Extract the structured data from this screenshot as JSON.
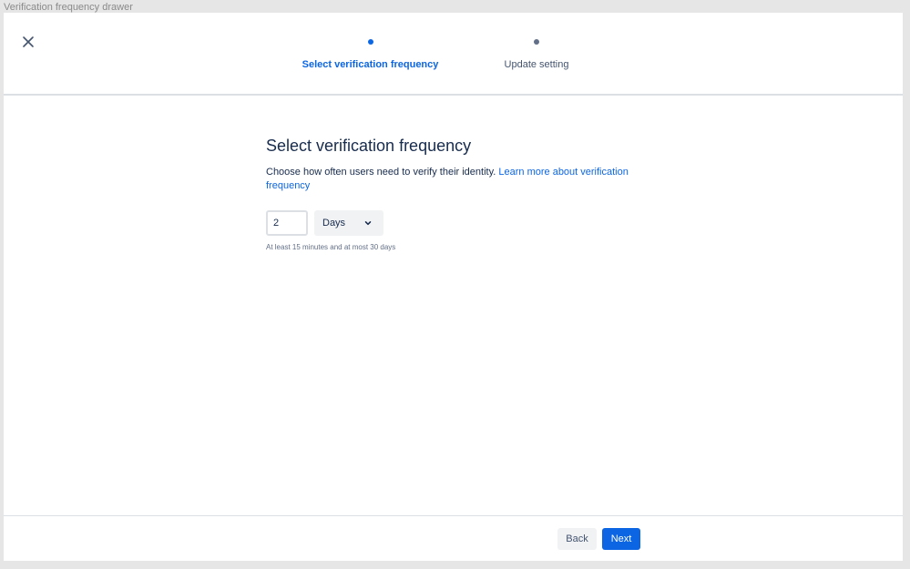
{
  "frame": {
    "title": "Verification frequency drawer"
  },
  "header": {
    "close_icon": "close-icon",
    "steps": [
      {
        "label": "Select verification frequency",
        "state": "current"
      },
      {
        "label": "Update setting",
        "state": "upcoming"
      }
    ]
  },
  "main": {
    "title": "Select verification frequency",
    "description": "Choose how often users need to verify their identity.",
    "learn_more_link": "Learn more about verification frequency",
    "frequency_value": "2",
    "unit_selected": "Days",
    "hint": "At least 15 minutes and at most 30 days"
  },
  "footer": {
    "back_label": "Back",
    "next_label": "Next"
  },
  "colors": {
    "accent": "#0c66e4",
    "text": "#172b4d",
    "subtle": "#626f86"
  }
}
